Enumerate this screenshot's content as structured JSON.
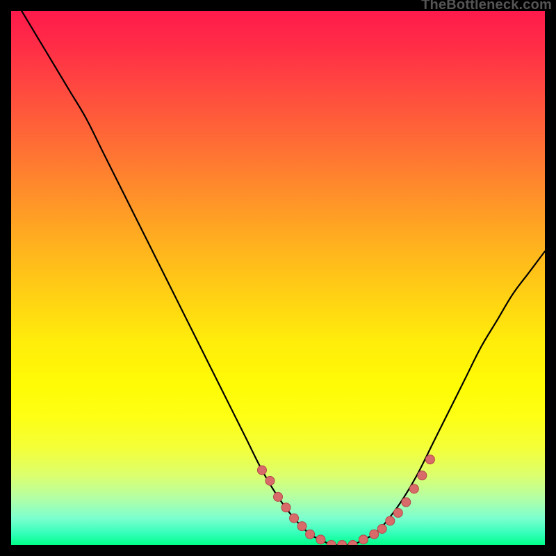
{
  "watermark": "TheBottleneck.com",
  "colors": {
    "background": "#000000",
    "curve": "#000000",
    "points_fill": "#d86a6a",
    "points_stroke": "#b44848"
  },
  "chart_data": {
    "type": "line",
    "title": "",
    "xlabel": "",
    "ylabel": "",
    "xlim": [
      0,
      100
    ],
    "ylim": [
      0,
      100
    ],
    "grid": false,
    "series": [
      {
        "name": "bottleneck-curve",
        "x": [
          2,
          5,
          8,
          11,
          14,
          17,
          20,
          23,
          26,
          29,
          32,
          35,
          38,
          41,
          44,
          47,
          50,
          53,
          56,
          58,
          60,
          62,
          64,
          66,
          68,
          70,
          73,
          76,
          79,
          82,
          85,
          88,
          91,
          94,
          97,
          100
        ],
        "y": [
          100,
          95,
          90,
          85,
          80,
          74,
          68,
          62,
          56,
          50,
          44,
          38,
          32,
          26,
          20,
          14,
          9,
          5,
          2,
          1,
          0,
          0,
          0,
          1,
          2,
          4,
          8,
          13,
          19,
          25,
          31,
          37,
          42,
          47,
          51,
          55
        ]
      }
    ],
    "highlight_points": {
      "name": "near-optimum-markers",
      "x": [
        47,
        48.5,
        50,
        51.5,
        53,
        54.5,
        56,
        58,
        60,
        62,
        64,
        66,
        68,
        69.5,
        71,
        72.5,
        74,
        75.5,
        77,
        78.5
      ],
      "y": [
        14,
        12,
        9,
        7,
        5,
        3.5,
        2,
        1,
        0,
        0,
        0,
        1,
        2,
        3,
        4.5,
        6,
        8,
        10.5,
        13,
        16
      ]
    }
  }
}
